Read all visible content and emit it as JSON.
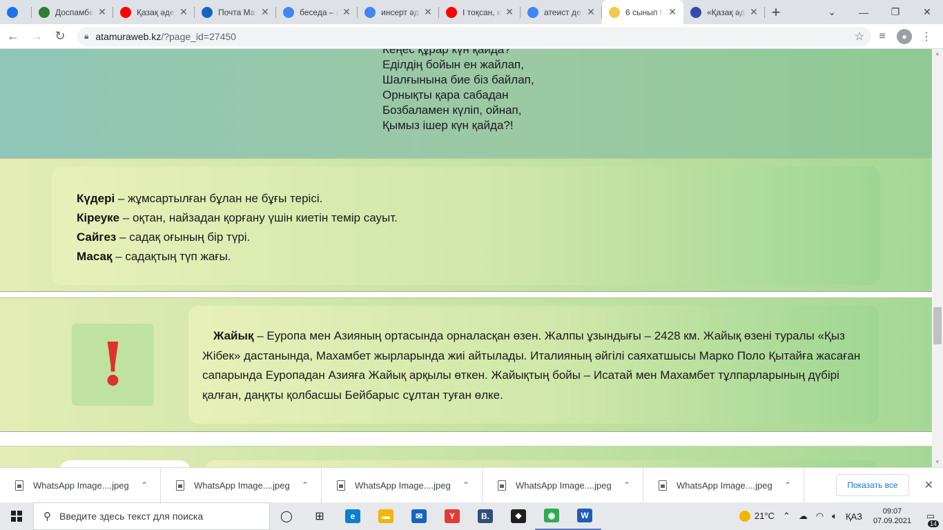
{
  "tabs": [
    {
      "favicon": "site-logo-icon",
      "title": "",
      "color": "#1a73e8"
    },
    {
      "favicon": "globe-logo-icon",
      "title": "Доспамбе",
      "color": "#2e7d32"
    },
    {
      "favicon": "youtube-icon",
      "title": "Қазақ әде",
      "color": "#ff0000"
    },
    {
      "favicon": "mail-icon",
      "title": "Почта Ма",
      "color": "#1565c0"
    },
    {
      "favicon": "google-icon",
      "title": "беседа – (",
      "color": "#4285f4"
    },
    {
      "favicon": "google-icon",
      "title": "инсерт әд",
      "color": "#4285f4"
    },
    {
      "favicon": "youtube-icon",
      "title": "І тоқсан, к",
      "color": "#ff0000"
    },
    {
      "favicon": "google-icon",
      "title": "атеист де",
      "color": "#4285f4"
    },
    {
      "favicon": "sun-logo-icon",
      "title": "6 сынып !",
      "color": "#f2c94c",
      "active": true
    },
    {
      "favicon": "circle-logo-icon",
      "title": "«Қазақ әд",
      "color": "#3949ab"
    }
  ],
  "toolbar": {
    "url_host": "atamuraweb.kz",
    "url_path": "/?page_id=27450"
  },
  "poem": {
    "lines": [
      "Кеңес құрар күн қайда?",
      "Еділдің бойын ен жайлап,",
      "Шалғынына бие біз байлап,",
      "Орнықты қара сабадан",
      "Бозбаламен күліп, ойнап,",
      "Қымыз ішер күн қайда?!"
    ]
  },
  "glossary": [
    {
      "term": "Күдері",
      "definition": " – жұмсартылған бұлан не бұғы терісі."
    },
    {
      "term": "Кіреуке",
      "definition": " – оқтан, найзадан қорғану үшін киетін темір сауыт."
    },
    {
      "term": "Сайгез",
      "definition": " – садақ оғының бір түрі."
    },
    {
      "term": "Масақ",
      "definition": " – садақтың түп жағы."
    }
  ],
  "info": {
    "alert_symbol": "!",
    "term": "Жайық",
    "text": " – Еуропа мен Азияның ортасында орналасқан өзен. Жалпы ұзындығы – 2428 км. Жайық өзені туралы «Қыз Жібек» дастанында, Махамбет жырларында жиі айтылады. Италияның әйгілі саяхатшысы Марко Поло Қытайға жасаған сапарында Еуропадан Азияға Жайық арқылы өткен. Жайықтың бойы – Исатай мен Махамбет тұлпарларының дүбірі қалған, даңқты қолбасшы Бейбарыс сұлтан туған өлке."
  },
  "downloads": {
    "items": [
      "WhatsApp Image....jpeg",
      "WhatsApp Image....jpeg",
      "WhatsApp Image....jpeg",
      "WhatsApp Image....jpeg",
      "WhatsApp Image....jpeg"
    ],
    "show_all_label": "Показать все"
  },
  "taskbar": {
    "search_placeholder": "Введите здесь текст для поиска",
    "apps": [
      {
        "name": "task-view-icon",
        "glyph": "◯"
      },
      {
        "name": "widgets-icon",
        "glyph": "⊞"
      },
      {
        "name": "edge-icon",
        "glyph": "e",
        "color": "#0c7fd0"
      },
      {
        "name": "file-explorer-icon",
        "glyph": "▬",
        "color": "#f2b600"
      },
      {
        "name": "mail-app-icon",
        "glyph": "✉",
        "color": "#1565c0"
      },
      {
        "name": "yandex-icon",
        "glyph": "Y",
        "color": "#e53935"
      },
      {
        "name": "b-app-icon",
        "glyph": "B.",
        "color": "#2f4f7a"
      },
      {
        "name": "dropbox-icon",
        "glyph": "❖",
        "color": "#1f1f1f"
      },
      {
        "name": "chrome-icon",
        "glyph": "◉",
        "color": "#34a853",
        "running": true
      },
      {
        "name": "word-icon",
        "glyph": "W",
        "color": "#1f5cb8",
        "running": true
      }
    ],
    "weather": "21°C",
    "language": "ҚАЗ",
    "time": "09:07",
    "date": "07.09.2021",
    "notifications": "14"
  }
}
